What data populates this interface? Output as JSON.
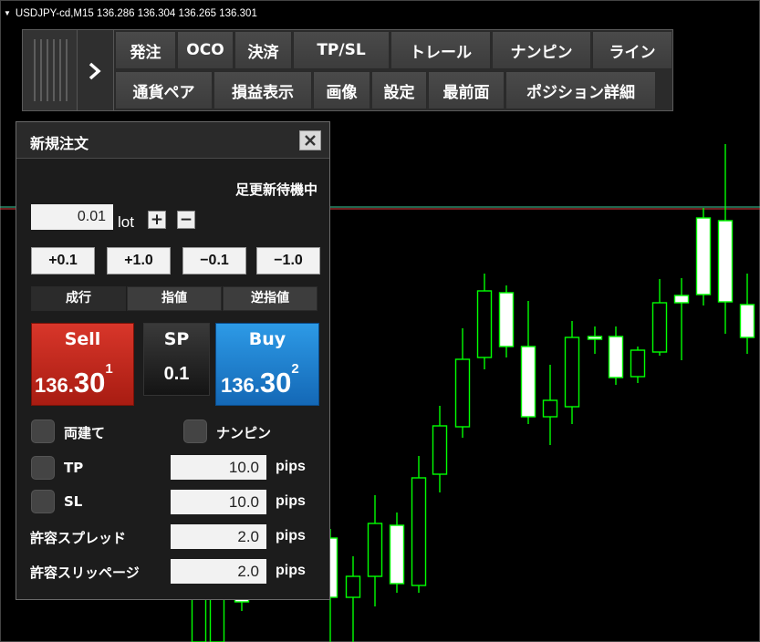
{
  "chart": {
    "title": "USDJPY-cd,M15  136.286 136.304 136.265 136.301",
    "colors": {
      "bull": "#ffffff",
      "bear": "#000000",
      "wick": "#00ff00",
      "outline": "#00ff00",
      "bid_line": "#e04040",
      "ask_line": "#40d0a0"
    }
  },
  "toolbar": {
    "row1": [
      "発注",
      "OCO",
      "決済",
      "TP/SL",
      "トレール",
      "ナンピン",
      "ライン"
    ],
    "row2": [
      "通貨ペア",
      "損益表示",
      "画像",
      "設定",
      "最前面",
      "ポジション詳細"
    ]
  },
  "panel": {
    "title": "新規注文",
    "status": "足更新待機中",
    "lot_value": "0.01",
    "lot_unit": "lot",
    "plus": "+",
    "minus": "−",
    "step_buttons": [
      "+0.1",
      "+1.0",
      "−0.1",
      "−1.0"
    ],
    "order_types": [
      "成行",
      "指値",
      "逆指値"
    ],
    "sell": {
      "label": "Sell",
      "price_small": "136.",
      "price_big": "30",
      "price_sup": "1"
    },
    "spread": {
      "label": "SP",
      "value": "0.1"
    },
    "buy": {
      "label": "Buy",
      "price_small": "136.",
      "price_big": "30",
      "price_sup": "2"
    },
    "options": {
      "ryoudate": "両建て",
      "nanpin": "ナンピン"
    },
    "tp": {
      "label": "TP",
      "value": "10.0",
      "unit": "pips"
    },
    "sl": {
      "label": "SL",
      "value": "10.0",
      "unit": "pips"
    },
    "spread_limit": {
      "label": "許容スプレッド",
      "value": "2.0",
      "unit": "pips"
    },
    "slippage": {
      "label": "許容スリッページ",
      "value": "2.0",
      "unit": "pips"
    }
  }
}
